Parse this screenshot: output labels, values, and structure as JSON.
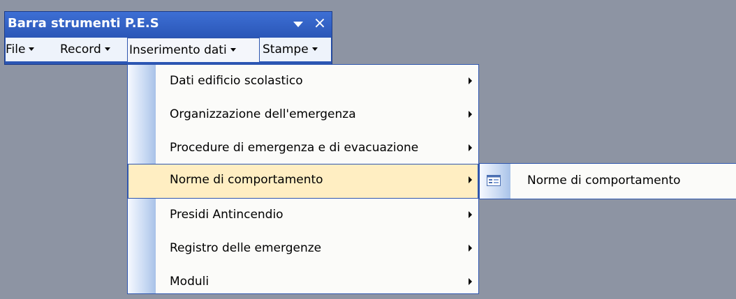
{
  "window": {
    "title": "Barra strumenti P.E.S",
    "close_glyph": "×"
  },
  "menubar": {
    "items": [
      {
        "label": "File"
      },
      {
        "label": "Record"
      },
      {
        "label": "Inserimento dati",
        "open": true
      },
      {
        "label": "Stampe"
      }
    ]
  },
  "dropdown": {
    "items": [
      {
        "label": "Dati edificio scolastico",
        "has_submenu": true
      },
      {
        "label": "Organizzazione dell'emergenza",
        "has_submenu": true
      },
      {
        "label": "Procedure di emergenza e di evacuazione",
        "has_submenu": true
      },
      {
        "label": "Norme di comportamento",
        "has_submenu": true,
        "highlighted": true
      },
      {
        "label": "Presidi Antincendio",
        "has_submenu": true
      },
      {
        "label": "Registro delle emergenze",
        "has_submenu": true
      },
      {
        "label": "Moduli",
        "has_submenu": true
      }
    ]
  },
  "submenu": {
    "items": [
      {
        "label": "Norme di comportamento",
        "icon": "form-icon"
      }
    ]
  },
  "colors": {
    "desktop": "#8d94a3",
    "title_bar": "#2b56b4",
    "menu_bar": "#eef3fb",
    "highlight": "#ffeec2",
    "border": "#2f56ae"
  }
}
